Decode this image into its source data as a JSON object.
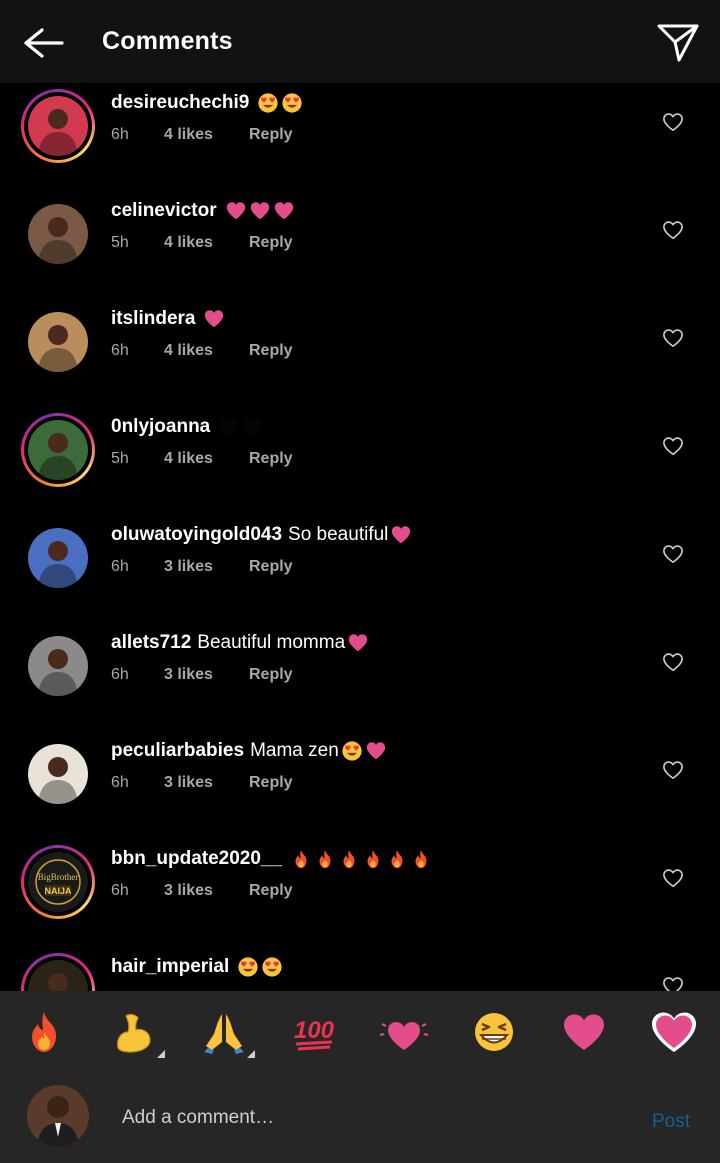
{
  "header": {
    "title": "Comments",
    "back_icon": "arrow-left-icon",
    "send_icon": "paper-plane-icon"
  },
  "colors": {
    "background": "#000000",
    "topbar": "#121212",
    "panel": "#262626",
    "meta_text": "#a8a8a8",
    "post_link": "#1c5d8a",
    "emoji_heart": "#e44d8c"
  },
  "comments": [
    {
      "username": "desireuchechi9",
      "text": "",
      "emojis": [
        "heart-eyes",
        "heart-eyes"
      ],
      "time": "6h",
      "likes": "4 likes",
      "reply": "Reply",
      "story_ring": true,
      "avatar_color": "#d23a4f"
    },
    {
      "username": "celinevictor",
      "text": "",
      "emojis": [
        "pink-heart",
        "pink-heart",
        "pink-heart"
      ],
      "time": "5h",
      "likes": "4 likes",
      "reply": "Reply",
      "story_ring": false,
      "avatar_color": "#7a5a44"
    },
    {
      "username": "itslindera",
      "text": "",
      "emojis": [
        "pink-heart"
      ],
      "time": "6h",
      "likes": "4 likes",
      "reply": "Reply",
      "story_ring": false,
      "avatar_color": "#b98e5c"
    },
    {
      "username": "0nlyjoanna",
      "text": "",
      "emojis": [
        "black-heart",
        "black-heart"
      ],
      "time": "5h",
      "likes": "4 likes",
      "reply": "Reply",
      "story_ring": true,
      "avatar_color": "#3c6a3a"
    },
    {
      "username": "oluwatoyingold043",
      "text": "So beautiful",
      "emojis": [
        "pink-heart"
      ],
      "time": "6h",
      "likes": "3 likes",
      "reply": "Reply",
      "story_ring": false,
      "avatar_color": "#4a6fc0"
    },
    {
      "username": "allets712",
      "text": "Beautiful momma",
      "emojis": [
        "pink-heart"
      ],
      "time": "6h",
      "likes": "3 likes",
      "reply": "Reply",
      "story_ring": false,
      "avatar_color": "#8a8a8a"
    },
    {
      "username": "peculiarbabies",
      "text": "Mama zen",
      "emojis": [
        "heart-eyes",
        "pink-heart"
      ],
      "time": "6h",
      "likes": "3 likes",
      "reply": "Reply",
      "story_ring": false,
      "avatar_color": "#e8e2d8"
    },
    {
      "username": "bbn_update2020__",
      "text": "",
      "emojis": [
        "fire",
        "fire",
        "fire",
        "fire",
        "fire",
        "fire"
      ],
      "time": "6h",
      "likes": "3 likes",
      "reply": "Reply",
      "story_ring": true,
      "avatar_color": "#1a1a1a",
      "avatar_label_1": "BigBrother",
      "avatar_label_2": "NAIJA"
    },
    {
      "username": "hair_imperial",
      "text": "",
      "emojis": [
        "heart-eyes",
        "heart-eyes"
      ],
      "time": "",
      "likes": "",
      "reply": "",
      "story_ring": true,
      "avatar_color": "#2a2418"
    }
  ],
  "emoji_bar": [
    {
      "name": "fire-emoji",
      "has_variants": false
    },
    {
      "name": "flexed-biceps-emoji",
      "has_variants": true
    },
    {
      "name": "folded-hands-emoji",
      "has_variants": true
    },
    {
      "name": "hundred-points-emoji",
      "has_variants": false
    },
    {
      "name": "two-hearts-emoji",
      "has_variants": false
    },
    {
      "name": "grinning-squinting-emoji",
      "has_variants": false
    },
    {
      "name": "pink-heart-emoji",
      "has_variants": false
    },
    {
      "name": "growing-heart-emoji",
      "has_variants": false
    }
  ],
  "composer": {
    "placeholder": "Add a comment…",
    "post_label": "Post"
  }
}
